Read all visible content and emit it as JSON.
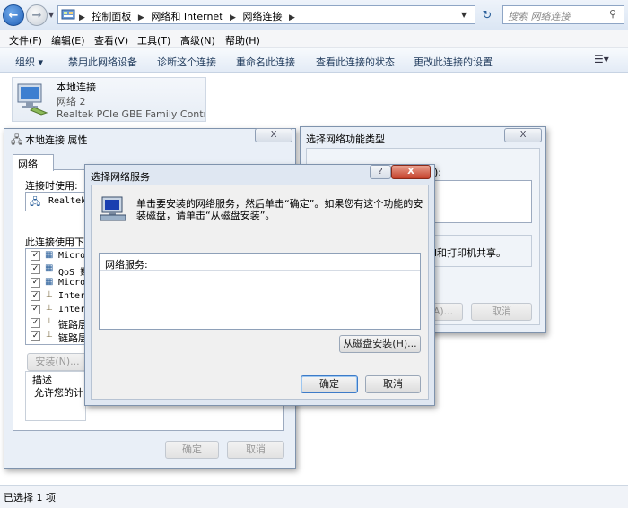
{
  "address": {
    "crumbs": [
      "控制面板",
      "网络和 Internet",
      "网络连接"
    ],
    "search_placeholder": "搜索 网络连接"
  },
  "menu": [
    "文件(F)",
    "编辑(E)",
    "查看(V)",
    "工具(T)",
    "高级(N)",
    "帮助(H)"
  ],
  "commands": {
    "organize": "组织 ▾",
    "disable": "禁用此网络设备",
    "diagnose": "诊断这个连接",
    "rename": "重命名此连接",
    "status": "查看此连接的状态",
    "settings": "更改此连接的设置"
  },
  "connection": {
    "name": "本地连接",
    "network": "网络  2",
    "adapter": "Realtek PCIe GBE Family Contr..."
  },
  "props": {
    "title": "本地连接 属性",
    "close": "X",
    "tab": "网络",
    "connect_using": "连接时使用:",
    "adapter": "Realtek",
    "uses_label": "此连接使用下列",
    "items": [
      "Micros",
      "QoS 数",
      "Micros",
      "Interr",
      "Interr",
      "链路层",
      "链路层"
    ],
    "install": "安装(N)...",
    "desc_title": "描述",
    "desc_text": "允许您的计",
    "ok": "确定",
    "cancel": "取消"
  },
  "feature": {
    "title": "选择网络功能类型",
    "close": "X",
    "colon": "):",
    "share_text": "l和打印机共享。",
    "add": "A)...",
    "cancel": "取消"
  },
  "service": {
    "title": "选择网络服务",
    "help": "?",
    "close": "X",
    "instruction_line1": "单击要安装的网络服务，然后单击“确定”。如果您有这个功能的安",
    "instruction_line2": "装磁盘，请单击“从磁盘安装”。",
    "list_header": "网络服务:",
    "have_disk": "从磁盘安装(H)...",
    "ok": "确定",
    "cancel": "取消"
  },
  "statusbar": {
    "text": "已选择 1 项"
  }
}
